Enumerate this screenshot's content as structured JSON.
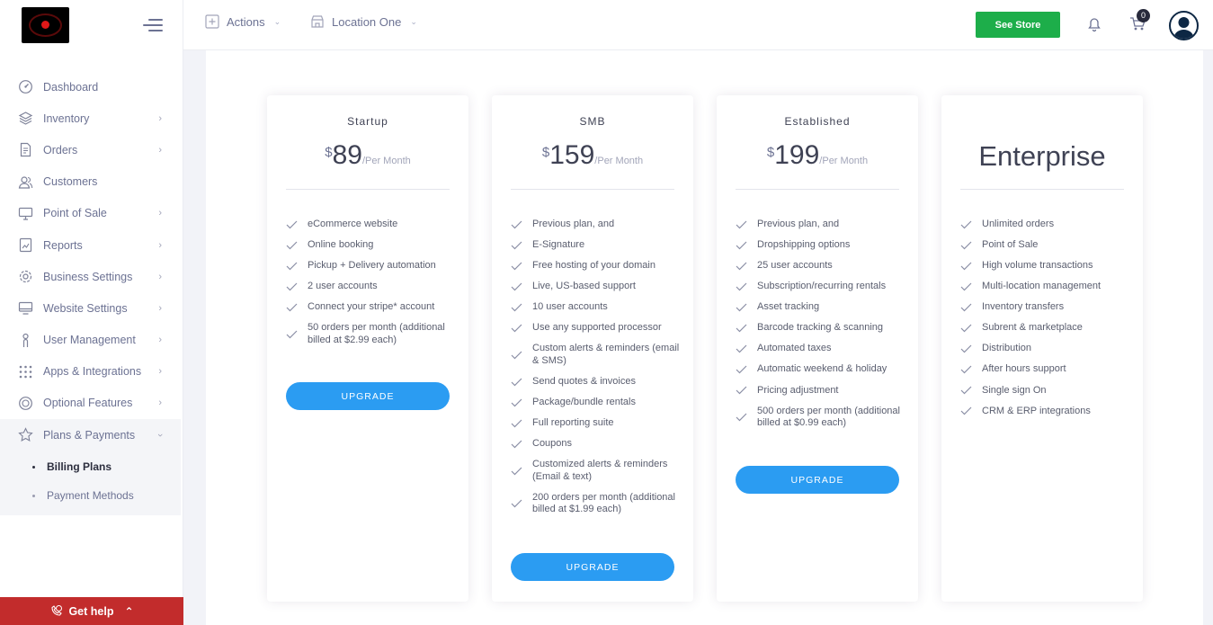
{
  "header": {
    "actions_label": "Actions",
    "location_label": "Location One",
    "see_store_label": "See Store",
    "cart_count": "0"
  },
  "sidebar": {
    "items": [
      {
        "label": "Dashboard",
        "icon": "dashboard-icon"
      },
      {
        "label": "Inventory",
        "icon": "layers-icon"
      },
      {
        "label": "Orders",
        "icon": "document-icon"
      },
      {
        "label": "Customers",
        "icon": "users-icon"
      },
      {
        "label": "Point of Sale",
        "icon": "monitor-icon"
      },
      {
        "label": "Reports",
        "icon": "chart-icon"
      },
      {
        "label": "Business Settings",
        "icon": "gear-icon"
      },
      {
        "label": "Website Settings",
        "icon": "desktop-icon"
      },
      {
        "label": "User Management",
        "icon": "user-touch-icon"
      },
      {
        "label": "Apps & Integrations",
        "icon": "grid-icon"
      },
      {
        "label": "Optional Features",
        "icon": "globe-icon"
      },
      {
        "label": "Plans & Payments",
        "icon": "star-icon"
      }
    ],
    "sub_items": [
      {
        "label": "Billing Plans"
      },
      {
        "label": "Payment Methods"
      }
    ],
    "get_help_label": "Get help"
  },
  "plans": [
    {
      "name": "Startup",
      "currency": "$",
      "amount": "89",
      "period": "/Per Month",
      "features": [
        "eCommerce website",
        "Online booking",
        "Pickup + Delivery automation",
        "2 user accounts",
        "Connect your stripe* account",
        "50 orders per month (additional billed at $2.99 each)"
      ],
      "button": "UPGRADE"
    },
    {
      "name": "SMB",
      "currency": "$",
      "amount": "159",
      "period": "/Per Month",
      "features": [
        "Previous plan, and",
        "E-Signature",
        "Free hosting of your domain",
        "Live, US-based support",
        "10 user accounts",
        "Use any supported processor",
        "Custom alerts & reminders (email & SMS)",
        "Send quotes & invoices",
        "Package/bundle rentals",
        "Full reporting suite",
        "Coupons",
        "Customized alerts & reminders (Email & text)",
        "200 orders per month (additional billed at $1.99 each)"
      ],
      "button": "UPGRADE"
    },
    {
      "name": "Established",
      "currency": "$",
      "amount": "199",
      "period": "/Per Month",
      "features": [
        "Previous plan, and",
        "Dropshipping options",
        "25 user accounts",
        "Subscription/recurring rentals",
        "Asset tracking",
        "Barcode tracking & scanning",
        "Automated taxes",
        "Automatic weekend & holiday",
        "Pricing adjustment",
        "500 orders per month (additional billed at $0.99 each)"
      ],
      "button": "UPGRADE"
    },
    {
      "name": "Enterprise",
      "features": [
        "Unlimited orders",
        "Point of Sale",
        "High volume transactions",
        "Multi-location management",
        "Inventory transfers",
        "Subrent & marketplace",
        "Distribution",
        "After hours support",
        "Single sign On",
        "CRM & ERP integrations"
      ]
    }
  ],
  "colors": {
    "primary": "#2b9cf2",
    "success": "#1dae4a",
    "help": "#c22c2c"
  }
}
